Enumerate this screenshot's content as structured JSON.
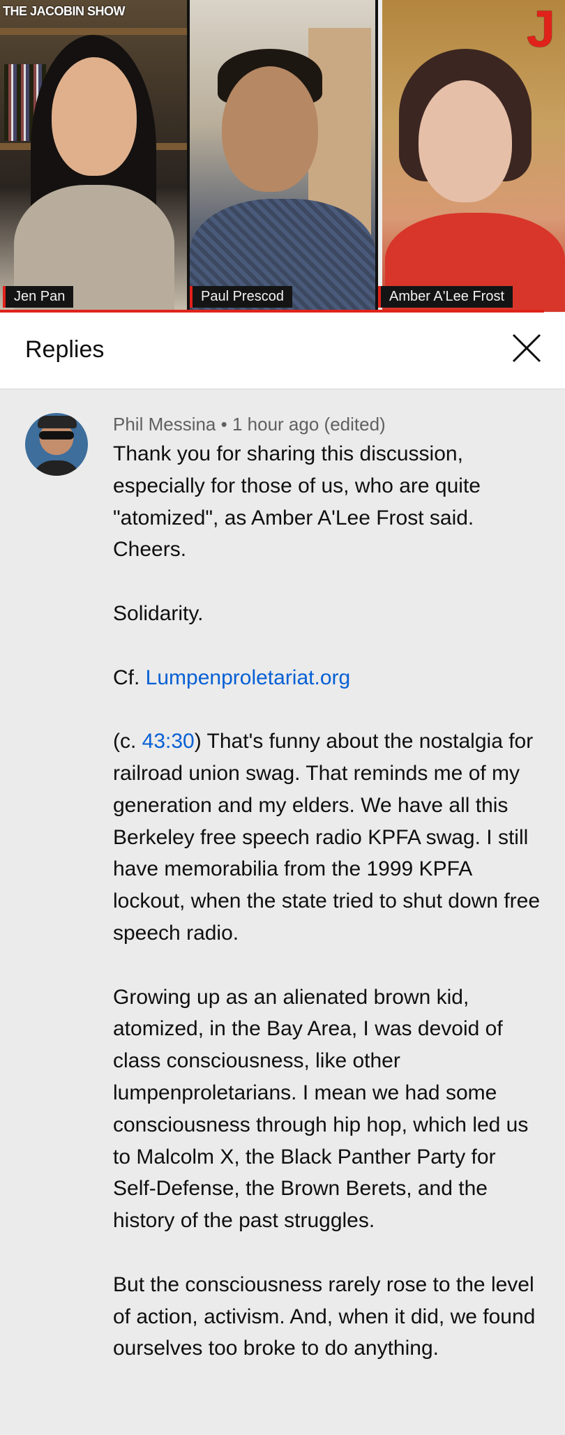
{
  "video": {
    "show_title": "THE JACOBIN SHOW",
    "logo": "J",
    "participants": [
      {
        "name": "Jen Pan"
      },
      {
        "name": "Paul Prescod"
      },
      {
        "name": "Amber A'Lee Frost"
      }
    ],
    "accent_color": "#e0221b"
  },
  "replies_panel": {
    "title": "Replies",
    "close_icon": "close-icon"
  },
  "comment": {
    "author": "Phil Messina",
    "separator": "•",
    "time": "1 hour ago (edited)",
    "p1": "Thank you for sharing this discussion, especially for those of us, who are quite \"atomized\", as Amber A'Lee Frost said. Cheers.",
    "p2": "Solidarity.",
    "p3_prefix": "Cf. ",
    "p3_link": "Lumpenproletariat.org",
    "p4_prefix": "(c. ",
    "p4_timestamp": "43:30",
    "p4_rest": ")  That's funny about the nostalgia for railroad union swag.  That reminds me of my generation and my elders.  We have all this Berkeley free speech radio KPFA swag.  I still have memorabilia from the 1999 KPFA lockout, when the state tried to shut down free speech radio.",
    "p5": "Growing up as an alienated brown kid, atomized, in the Bay Area, I was devoid of class consciousness, like other lumpenproletarians.  I mean we had some consciousness through hip hop, which led us to Malcolm X, the Black Panther Party for Self-Defense, the Brown Berets, and the history of the past struggles.",
    "p6": "But the consciousness rarely rose to the level of action, activism.  And, when it did, we found ourselves too broke to do anything."
  }
}
